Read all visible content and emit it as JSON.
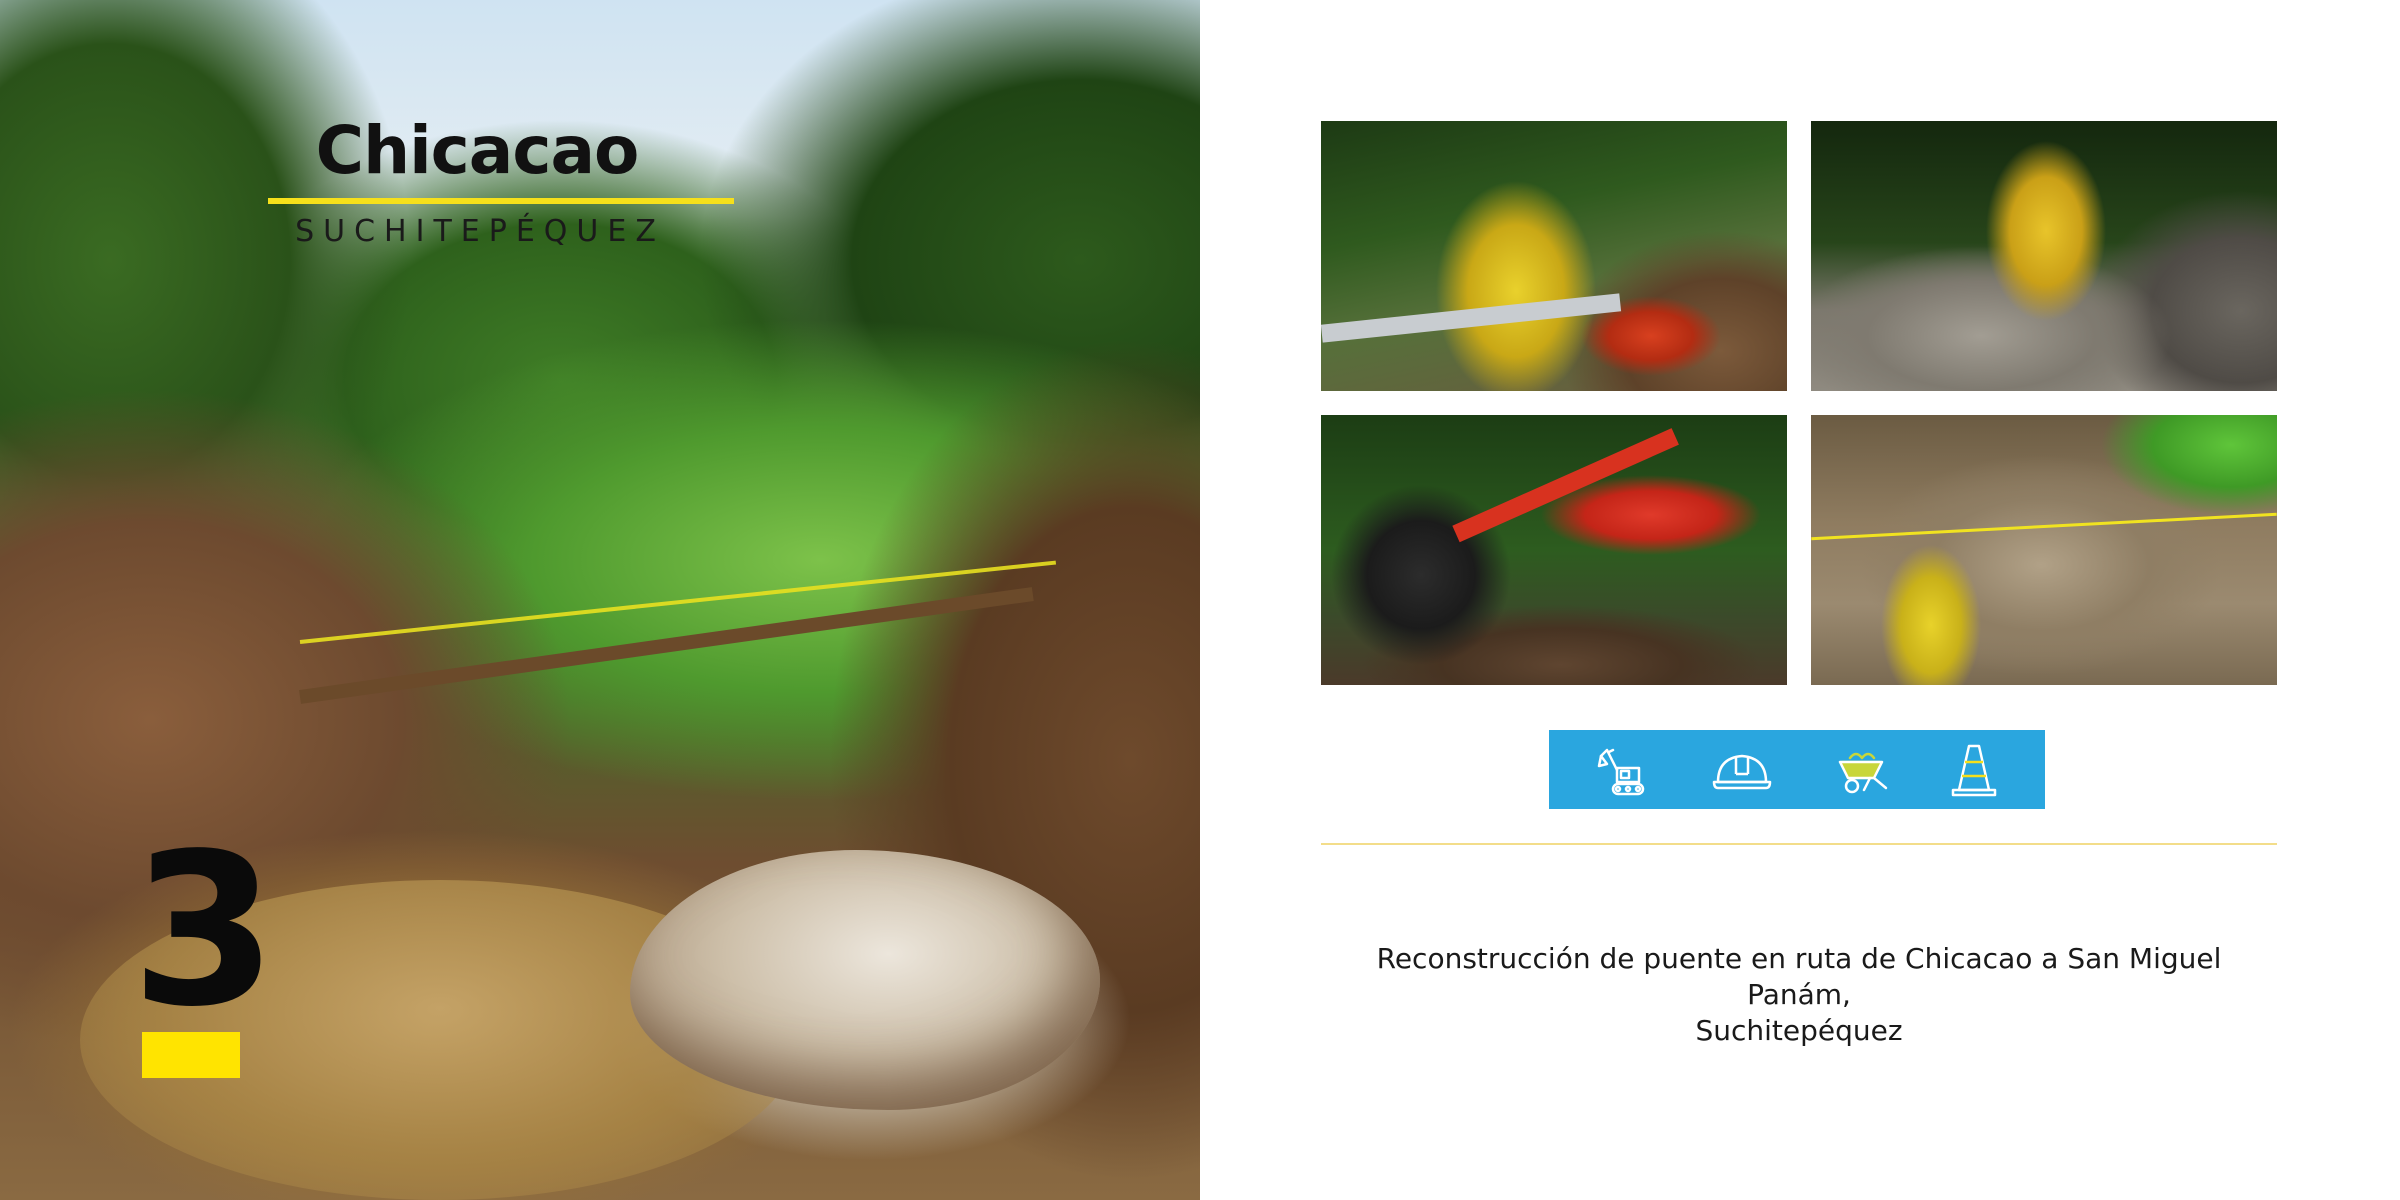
{
  "hero": {
    "title": "Chicacao",
    "subtitle": "SUCHITEPÉQUEZ",
    "number": "3"
  },
  "photos": [
    {
      "id": "worker-pipes-wheelbarrow"
    },
    {
      "id": "worker-shoveling-gravel"
    },
    {
      "id": "red-backhoe-excavator"
    },
    {
      "id": "bridge-foundation-site"
    }
  ],
  "icons": [
    {
      "name": "excavator-icon"
    },
    {
      "name": "hard-hat-icon"
    },
    {
      "name": "wheelbarrow-icon"
    },
    {
      "name": "traffic-cone-icon"
    }
  ],
  "colors": {
    "accent_yellow": "#ffe400",
    "icon_band_blue": "#2aa6df",
    "divider": "#f3dd8a"
  },
  "caption": {
    "line1": "Reconstrucción de puente en ruta de Chicacao a San Miguel Panám,",
    "line2": "Suchitepéquez"
  }
}
